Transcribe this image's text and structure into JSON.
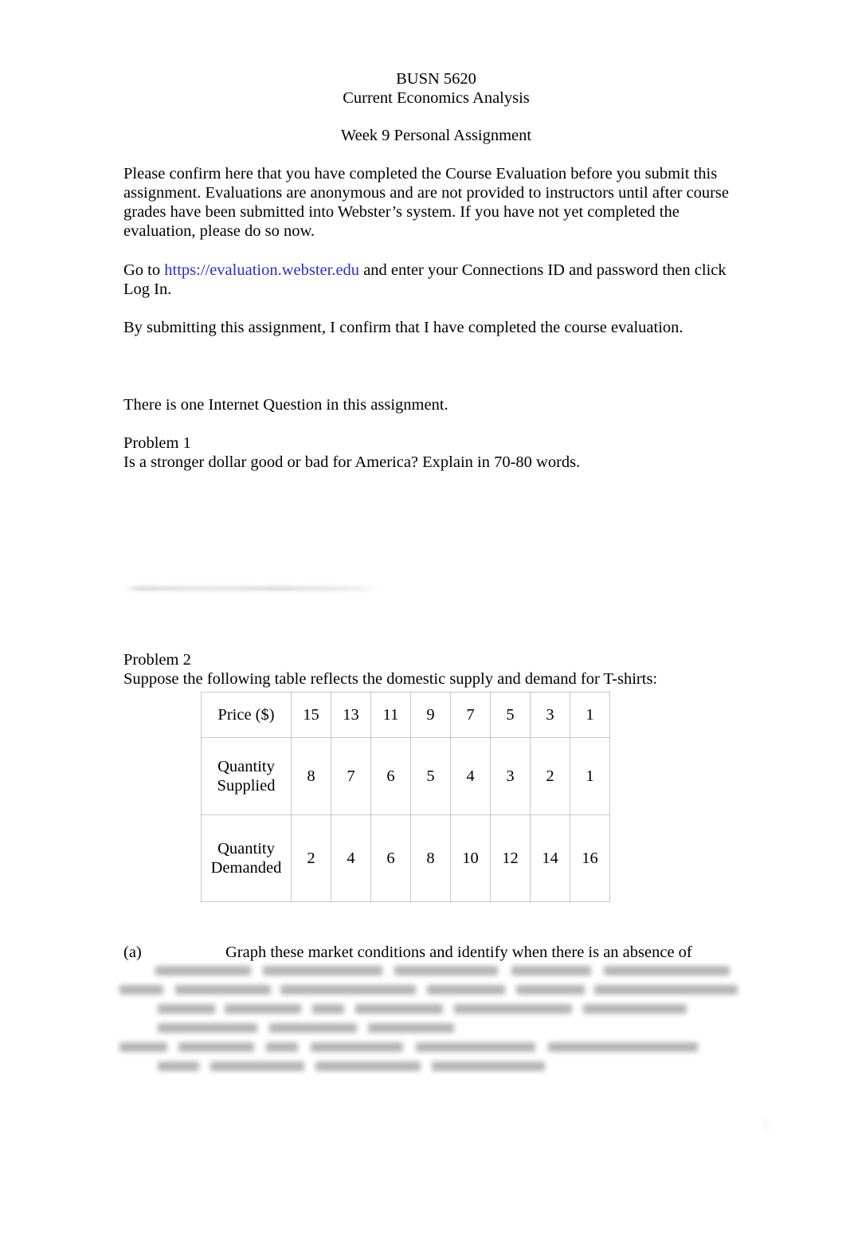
{
  "document": {
    "course_code": "BUSN 5620",
    "course_name": "Current Economics Analysis",
    "assignment_title": "Week 9 Personal Assignment",
    "page_number": "1"
  },
  "intro": {
    "paragraph_1": "Please confirm here that you have completed the Course Evaluation before you submit this assignment.  Evaluations are anonymous and are not provided to instructors until after course grades have been submitted into Webster’s system.   If you have not yet completed the evaluation, please do so now.",
    "goto_prefix": "Go to ",
    "link_text": "https://evaluation.webster.edu",
    "goto_suffix": " and enter your Connections ID and password then click Log In.",
    "link_color": "#2b2bd4",
    "confirmation": "By submitting this assignment, I confirm that I have completed the course evaluation.",
    "internet_question_note": "There is one Internet Question in this assignment."
  },
  "problems": [
    {
      "heading": "Problem 1",
      "prompt": "Is a stronger dollar good or bad for America?  Explain in 70-80 words.",
      "answer_visible": false
    },
    {
      "heading": "Problem 2",
      "prompt": "Suppose the following table reflects the domestic supply and demand for T-shirts:",
      "parts": [
        {
          "marker": "(a)",
          "text": "Graph these market conditions and identify when there is an absence of"
        }
      ]
    }
  ],
  "chart_data": {
    "type": "table",
    "title": "Domestic supply and demand for T-shirts",
    "row_labels": [
      "Price ($)",
      "Quantity Supplied",
      "Quantity Demanded"
    ],
    "categories": [
      "15",
      "13",
      "11",
      "9",
      "7",
      "5",
      "3",
      "1"
    ],
    "rows": [
      {
        "label": "Price ($)",
        "values": [
          15,
          13,
          11,
          9,
          7,
          5,
          3,
          1
        ]
      },
      {
        "label": "Quantity Supplied",
        "values": [
          8,
          7,
          6,
          5,
          4,
          3,
          2,
          1
        ]
      },
      {
        "label": "Quantity Demanded",
        "values": [
          2,
          4,
          6,
          8,
          10,
          12,
          14,
          16
        ]
      }
    ],
    "series": [
      {
        "name": "Quantity Supplied",
        "values": [
          8,
          7,
          6,
          5,
          4,
          3,
          2,
          1
        ]
      },
      {
        "name": "Quantity Demanded",
        "values": [
          2,
          4,
          6,
          8,
          10,
          12,
          14,
          16
        ]
      }
    ],
    "x": [
      15,
      13,
      11,
      9,
      7,
      5,
      3,
      1
    ],
    "xlabel": "Price ($)",
    "ylabel": "Quantity",
    "grid": true,
    "legend": "none"
  },
  "artifacts": {
    "redacted_answer_problem1": "",
    "redacted_answer_part_a": ""
  }
}
